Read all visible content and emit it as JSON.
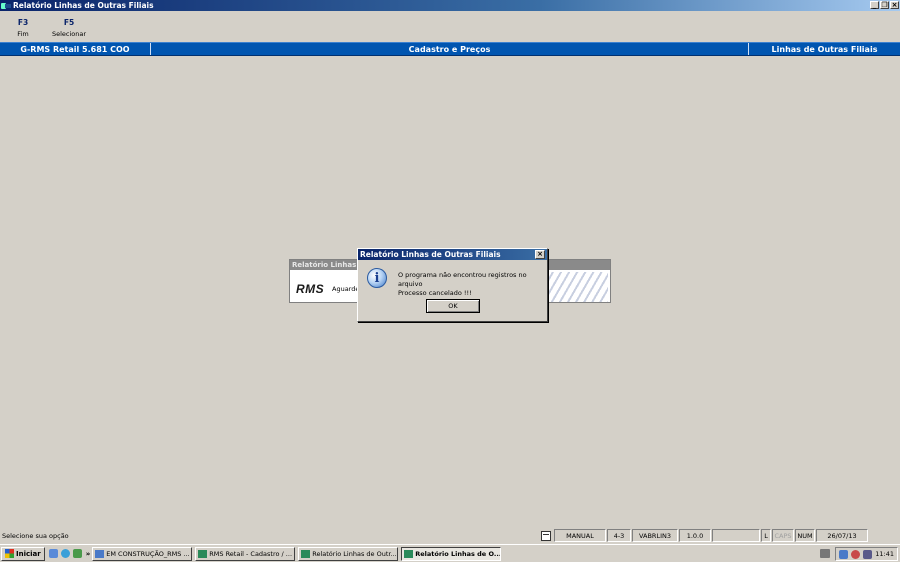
{
  "window": {
    "title": "Relatório Linhas de Outras  Filiais"
  },
  "fkeys": [
    {
      "key": "F3",
      "label": "Fim"
    },
    {
      "key": "F5",
      "label": "Selecionar"
    }
  ],
  "header": {
    "system": "G-RMS Retail 5.681 COO",
    "module": "Cadastro e Preços",
    "screen": "Linhas de Outras Filiais"
  },
  "background_window": {
    "title": "Relatório Linhas de",
    "logo": "RMS",
    "wait_text": "Aguarde"
  },
  "dialog": {
    "title": "Relatório Linhas de Outras  Filiais",
    "icon": "info-icon",
    "message_line1": "O programa não encontrou registros no arquivo",
    "message_line2": "Processo cancelado !!!",
    "ok_label": "OK",
    "close_label": "×"
  },
  "statusbar": {
    "message": "Selecione sua opção",
    "mode": "MANUAL",
    "position": "4-3",
    "program": "VABRLIN3",
    "version": "1.0.0",
    "blank": "",
    "l": "L",
    "caps": "CAPS",
    "num": "NUM",
    "date": "26/07/13"
  },
  "taskbar": {
    "start_label": "Iniciar",
    "more": "»",
    "tasks": [
      {
        "label": "EM CONSTRUÇÃO_RMS ...",
        "active": false
      },
      {
        "label": "RMS Retail - Cadastro / ...",
        "active": false
      },
      {
        "label": "Relatório Linhas de Outr...",
        "active": false
      },
      {
        "label": "Relatório Linhas de O...",
        "active": true
      }
    ],
    "clock": "11:41"
  },
  "colors": {
    "header_blue": "#0055b0",
    "title_gradient_start": "#0a246a",
    "surface": "#d4d0c8"
  }
}
